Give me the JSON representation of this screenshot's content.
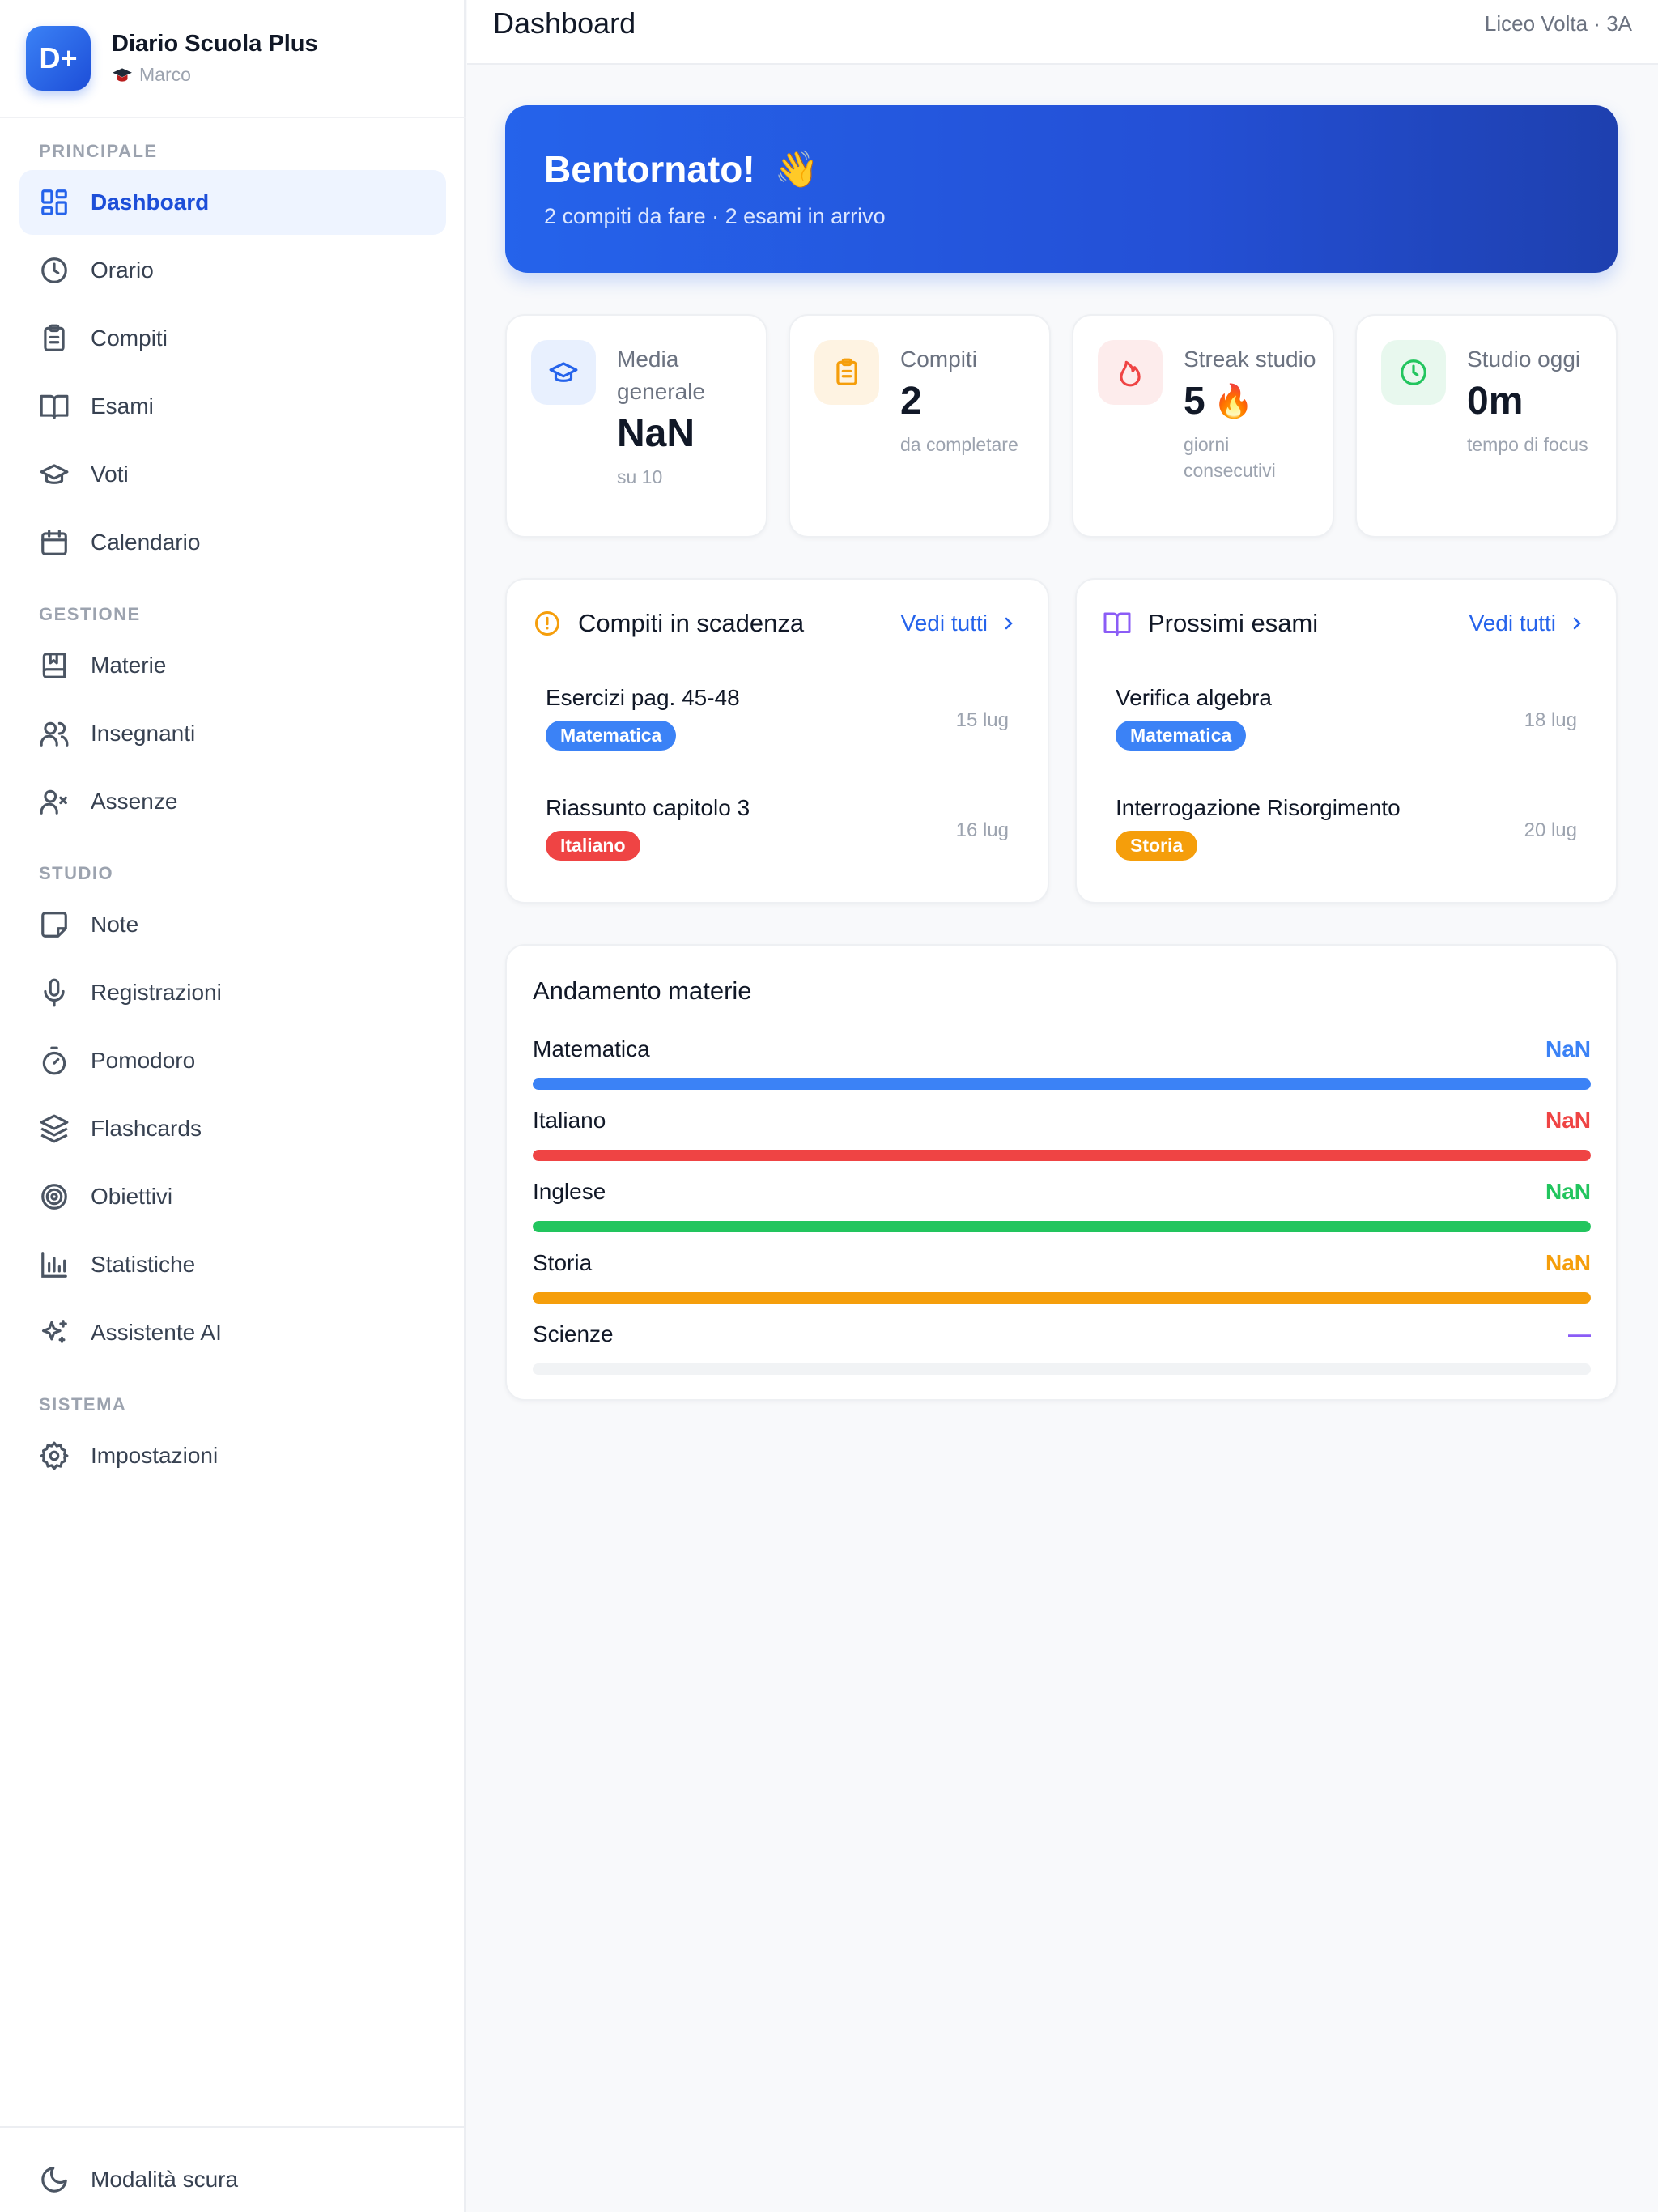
{
  "brand": {
    "logo": "D+",
    "name": "Diario Scuola Plus",
    "user": "Marco",
    "user_icon": "graduation-cap-icon"
  },
  "nav": {
    "sections": {
      "principale": "PRINCIPALE",
      "gestione": "GESTIONE",
      "studio": "STUDIO",
      "sistema": "SISTEMA"
    },
    "items": [
      {
        "label": "Dashboard",
        "icon": "grid-icon",
        "active": true
      },
      {
        "label": "Orario",
        "icon": "clock-icon"
      },
      {
        "label": "Compiti",
        "icon": "clipboard-icon"
      },
      {
        "label": "Esami",
        "icon": "book-open-icon"
      },
      {
        "label": "Voti",
        "icon": "graduation-cap-icon"
      },
      {
        "label": "Calendario",
        "icon": "calendar-icon"
      },
      {
        "label": "Materie",
        "icon": "book-bookmark-icon"
      },
      {
        "label": "Insegnanti",
        "icon": "users-icon"
      },
      {
        "label": "Assenze",
        "icon": "user-x-icon"
      },
      {
        "label": "Note",
        "icon": "sticky-note-icon"
      },
      {
        "label": "Registrazioni",
        "icon": "microphone-icon"
      },
      {
        "label": "Pomodoro",
        "icon": "timer-icon"
      },
      {
        "label": "Flashcards",
        "icon": "layers-icon"
      },
      {
        "label": "Obiettivi",
        "icon": "target-icon"
      },
      {
        "label": "Statistiche",
        "icon": "bar-chart-icon"
      },
      {
        "label": "Assistente AI",
        "icon": "sparkles-icon"
      },
      {
        "label": "Impostazioni",
        "icon": "gear-icon"
      }
    ],
    "dark_mode": {
      "label": "Modalità scura",
      "icon": "moon-icon"
    }
  },
  "header": {
    "title": "Dashboard",
    "school": "Liceo Volta · 3A"
  },
  "welcome": {
    "title": "Bentornato!",
    "emoji": "👋",
    "subtitle": "2 compiti da fare · 2 esami in arrivo"
  },
  "stats": [
    {
      "label": "Media generale",
      "value": "NaN",
      "sub": "su 10",
      "icon": "graduation-cap-icon",
      "color": "#2563eb",
      "bg": "#e8f0fe"
    },
    {
      "label": "Compiti",
      "value": "2",
      "sub": "da completare",
      "icon": "clipboard-icon",
      "color": "#f59e0b",
      "bg": "#fef3e2"
    },
    {
      "label": "Streak studio",
      "value": "5",
      "emoji": "🔥",
      "sub": "giorni consecutivi",
      "icon": "flame-icon",
      "color": "#ef4444",
      "bg": "#fdecec"
    },
    {
      "label": "Studio oggi",
      "value": "0m",
      "sub": "tempo di focus",
      "icon": "clock-icon",
      "color": "#22c55e",
      "bg": "#e8f8ee"
    }
  ],
  "homework": {
    "title": "Compiti in scadenza",
    "see_all": "Vedi tutti",
    "items": [
      {
        "title": "Esercizi pag. 45-48",
        "subject": "Matematica",
        "color": "#3b82f6",
        "date": "15 lug"
      },
      {
        "title": "Riassunto capitolo 3",
        "subject": "Italiano",
        "color": "#ef4444",
        "date": "16 lug"
      }
    ]
  },
  "exams": {
    "title": "Prossimi esami",
    "see_all": "Vedi tutti",
    "items": [
      {
        "title": "Verifica algebra",
        "subject": "Matematica",
        "color": "#3b82f6",
        "date": "18 lug"
      },
      {
        "title": "Interrogazione Risorgimento",
        "subject": "Storia",
        "color": "#f59e0b",
        "date": "20 lug"
      }
    ]
  },
  "progress": {
    "title": "Andamento materie",
    "subjects": [
      {
        "name": "Matematica",
        "value": "NaN",
        "color": "#3b82f6",
        "fill": 1.0
      },
      {
        "name": "Italiano",
        "value": "NaN",
        "color": "#ef4444",
        "fill": 1.0
      },
      {
        "name": "Inglese",
        "value": "NaN",
        "color": "#22c55e",
        "fill": 1.0
      },
      {
        "name": "Storia",
        "value": "NaN",
        "color": "#f59e0b",
        "fill": 1.0
      },
      {
        "name": "Scienze",
        "value": "—",
        "color": "#8b5cf6",
        "fill": 0.0
      }
    ]
  }
}
